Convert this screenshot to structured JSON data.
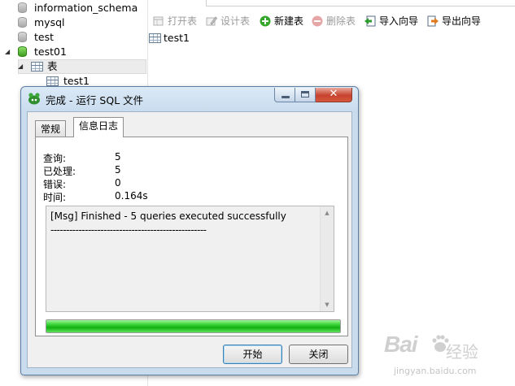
{
  "tree": {
    "databases": [
      {
        "label": "information_schema"
      },
      {
        "label": "mysql"
      },
      {
        "label": "test"
      },
      {
        "label": "test01"
      }
    ],
    "tables_node": "表",
    "table_item": "test1"
  },
  "toolbar": {
    "open_table": "打开表",
    "design_table": "设计表",
    "new_table": "新建表",
    "delete_table": "删除表",
    "import_wizard": "导入向导",
    "export_wizard": "导出向导"
  },
  "content": {
    "item": "test1"
  },
  "dialog": {
    "title": "完成 - 运行 SQL 文件",
    "tabs": [
      {
        "label": "常规",
        "active": false
      },
      {
        "label": "信息日志",
        "active": true
      }
    ],
    "stats": [
      {
        "label": "查询:",
        "value": "5"
      },
      {
        "label": "已处理:",
        "value": "5"
      },
      {
        "label": "错误:",
        "value": "0"
      },
      {
        "label": "时间:",
        "value": "0.164s"
      }
    ],
    "log": {
      "line1": "[Msg] Finished - 5 queries executed successfully",
      "line2": "--------------------------------------------------"
    },
    "progress": 1.0,
    "buttons": {
      "start": "开始",
      "close": "关闭"
    }
  },
  "watermark": {
    "brand": "Bai",
    "brand_cn": "经验",
    "url": "jingyan.baidu.com"
  },
  "colors": {
    "progress_green": "#12b012",
    "titlebar": "#c9dcee",
    "close_red": "#c7432e"
  }
}
